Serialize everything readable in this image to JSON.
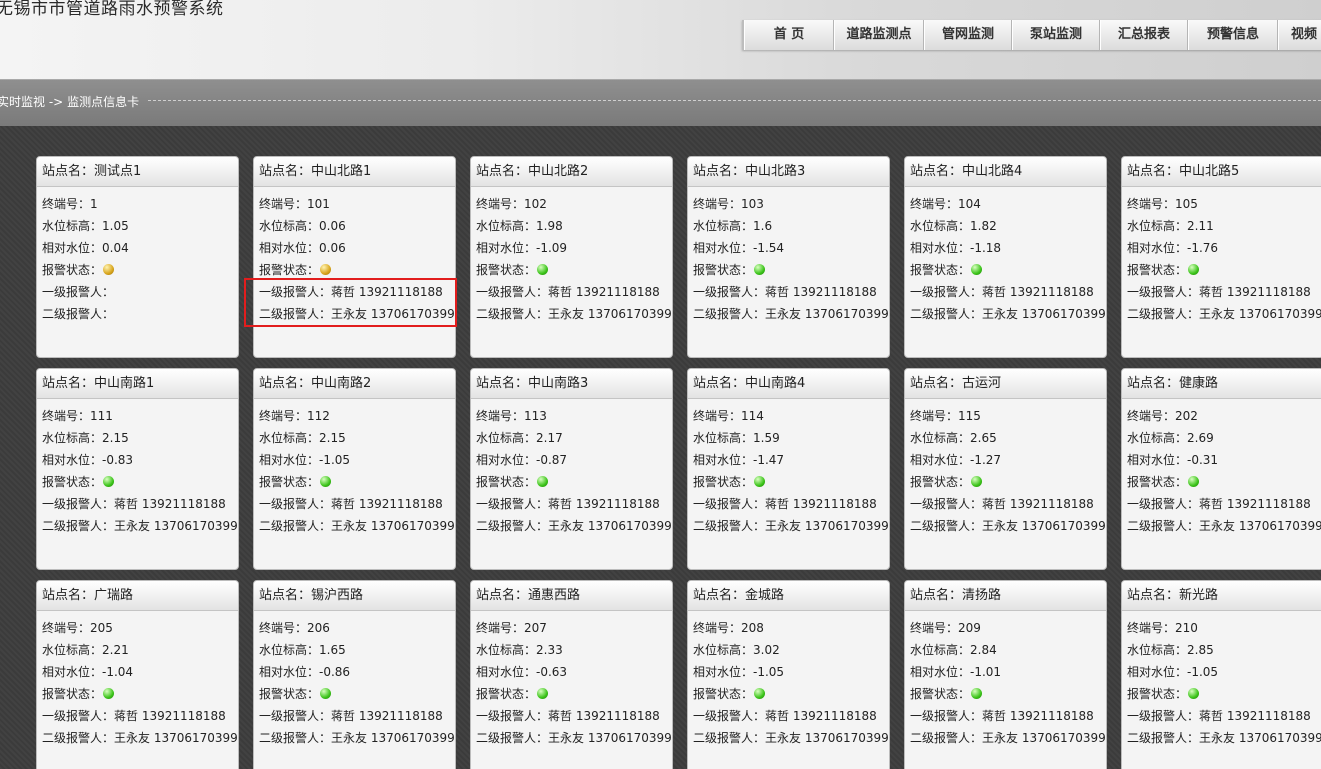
{
  "app": {
    "title": "无锡市市管道路雨水预警系统"
  },
  "nav": [
    {
      "label": "首 页"
    },
    {
      "label": "道路监测点"
    },
    {
      "label": "管网监测"
    },
    {
      "label": "泵站监测"
    },
    {
      "label": "汇总报表"
    },
    {
      "label": "预警信息"
    },
    {
      "label": "视频"
    }
  ],
  "breadcrumb": {
    "parent": "实时监视",
    "separator": "->",
    "current": "监测点信息卡"
  },
  "labels": {
    "station": "站点名：",
    "terminal": "终端号：",
    "level_elev": "水位标高：",
    "rel_level": "相对水位：",
    "alarm_status": "报警状态：",
    "contact1": "一级报警人：",
    "contact2": "二级报警人："
  },
  "colors": {
    "alarm_yellow": "#d8a51c",
    "alarm_green": "#3cc41a",
    "highlight": "#e21d1d"
  },
  "cards": [
    {
      "name": "测试点1",
      "terminal": "1",
      "elev": "1.05",
      "rel": "0.04",
      "status": "yellow",
      "c1": "",
      "c2": ""
    },
    {
      "name": "中山北路1",
      "terminal": "101",
      "elev": "0.06",
      "rel": "0.06",
      "status": "yellow",
      "c1": "蒋哲 13921118188",
      "c2": "王永友 13706170399"
    },
    {
      "name": "中山北路2",
      "terminal": "102",
      "elev": "1.98",
      "rel": "-1.09",
      "status": "green",
      "c1": "蒋哲 13921118188",
      "c2": "王永友 13706170399"
    },
    {
      "name": "中山北路3",
      "terminal": "103",
      "elev": "1.6",
      "rel": "-1.54",
      "status": "green",
      "c1": "蒋哲 13921118188",
      "c2": "王永友 13706170399"
    },
    {
      "name": "中山北路4",
      "terminal": "104",
      "elev": "1.82",
      "rel": "-1.18",
      "status": "green",
      "c1": "蒋哲 13921118188",
      "c2": "王永友 13706170399"
    },
    {
      "name": "中山北路5",
      "terminal": "105",
      "elev": "2.11",
      "rel": "-1.76",
      "status": "green",
      "c1": "蒋哲 13921118188",
      "c2": "王永友 13706170399"
    },
    {
      "name": "中山南路1",
      "terminal": "111",
      "elev": "2.15",
      "rel": "-0.83",
      "status": "green",
      "c1": "蒋哲 13921118188",
      "c2": "王永友 13706170399"
    },
    {
      "name": "中山南路2",
      "terminal": "112",
      "elev": "2.15",
      "rel": "-1.05",
      "status": "green",
      "c1": "蒋哲 13921118188",
      "c2": "王永友 13706170399"
    },
    {
      "name": "中山南路3",
      "terminal": "113",
      "elev": "2.17",
      "rel": "-0.87",
      "status": "green",
      "c1": "蒋哲 13921118188",
      "c2": "王永友 13706170399"
    },
    {
      "name": "中山南路4",
      "terminal": "114",
      "elev": "1.59",
      "rel": "-1.47",
      "status": "green",
      "c1": "蒋哲 13921118188",
      "c2": "王永友 13706170399"
    },
    {
      "name": "古运河",
      "terminal": "115",
      "elev": "2.65",
      "rel": "-1.27",
      "status": "green",
      "c1": "蒋哲 13921118188",
      "c2": "王永友 13706170399"
    },
    {
      "name": "健康路",
      "terminal": "202",
      "elev": "2.69",
      "rel": "-0.31",
      "status": "green",
      "c1": "蒋哲 13921118188",
      "c2": "王永友 13706170399"
    },
    {
      "name": "广瑞路",
      "terminal": "205",
      "elev": "2.21",
      "rel": "-1.04",
      "status": "green",
      "c1": "蒋哲 13921118188",
      "c2": "王永友 13706170399"
    },
    {
      "name": "锡沪西路",
      "terminal": "206",
      "elev": "1.65",
      "rel": "-0.86",
      "status": "green",
      "c1": "蒋哲 13921118188",
      "c2": "王永友 13706170399"
    },
    {
      "name": "通惠西路",
      "terminal": "207",
      "elev": "2.33",
      "rel": "-0.63",
      "status": "green",
      "c1": "蒋哲 13921118188",
      "c2": "王永友 13706170399"
    },
    {
      "name": "金城路",
      "terminal": "208",
      "elev": "3.02",
      "rel": "-1.05",
      "status": "green",
      "c1": "蒋哲 13921118188",
      "c2": "王永友 13706170399"
    },
    {
      "name": "清扬路",
      "terminal": "209",
      "elev": "2.84",
      "rel": "-1.01",
      "status": "green",
      "c1": "蒋哲 13921118188",
      "c2": "王永友 13706170399"
    },
    {
      "name": "新光路",
      "terminal": "210",
      "elev": "2.85",
      "rel": "-1.05",
      "status": "green",
      "c1": "蒋哲 13921118188",
      "c2": "王永友 13706170399"
    }
  ]
}
